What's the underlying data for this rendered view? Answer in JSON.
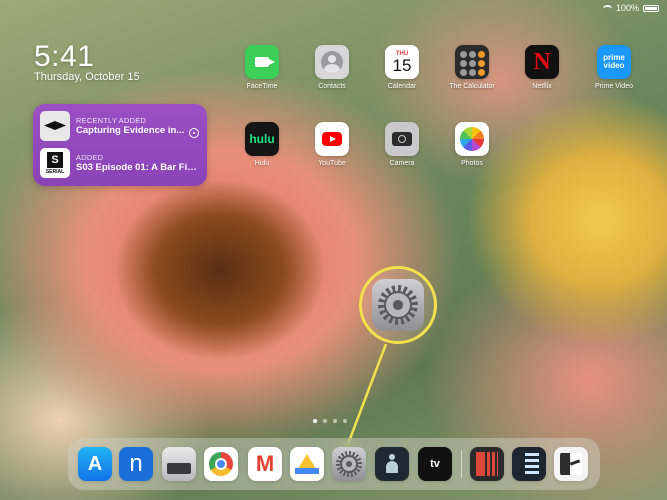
{
  "status_bar": {
    "wifi": "wifi-icon",
    "battery_text": "100%"
  },
  "lock": {
    "time": "5:41",
    "date": "Thursday, October 15"
  },
  "widget": {
    "row1_small": "RECENTLY ADDED",
    "row1_title": "Capturing Evidence in...",
    "row2_small": "ADDED",
    "row2_title": "S03 Episode 01: A Bar Figh...",
    "serial_badge": "S",
    "serial_label": "SERIAL"
  },
  "apps": {
    "facetime": "FaceTime",
    "contacts": "Contacts",
    "calendar": "Calendar",
    "calendar_day": "THU",
    "calendar_date": "15",
    "calculator": "The Calculator",
    "netflix": "Netflix",
    "netflix_glyph": "N",
    "prime": "Prime Video",
    "prime_glyph_1": "prime",
    "prime_glyph_2": "video",
    "hulu": "Hulu",
    "hulu_glyph": "hulu",
    "youtube": "YouTube",
    "camera": "Camera",
    "photos": "Photos"
  },
  "dock": {
    "appstore_glyph": "A",
    "n_glyph": "n",
    "gmail_glyph": "M",
    "appletv_glyph": "tv"
  },
  "colors": {
    "highlight": "#f2e14d",
    "widget": "#9b4fc2"
  }
}
